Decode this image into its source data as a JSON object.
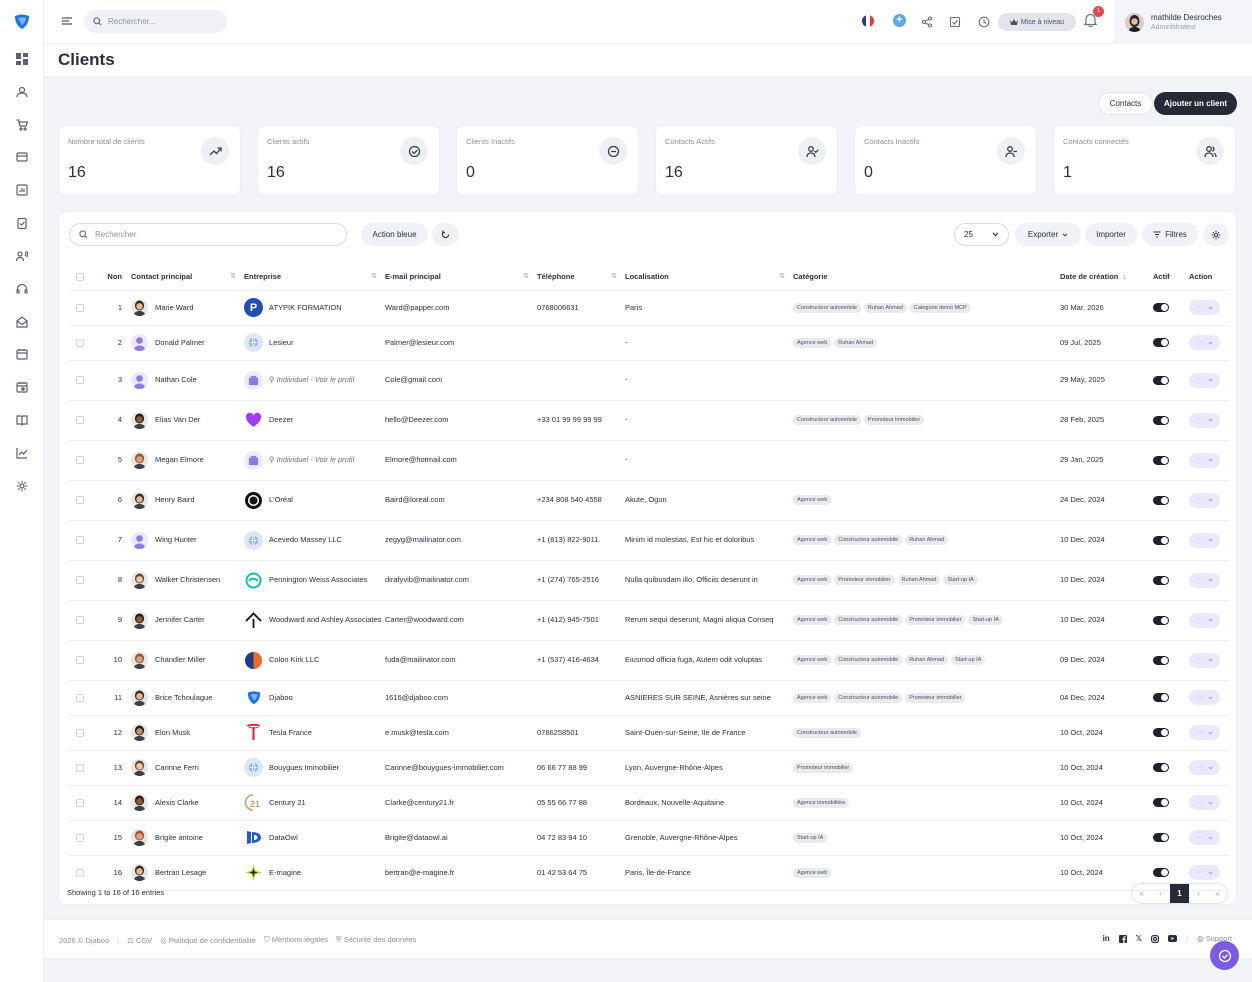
{
  "topbar": {
    "search_placeholder": "Rechercher...",
    "upgrade_label": "Mise à niveau",
    "notif_count": "1",
    "user_name": "mathilde Desroches",
    "user_role": "Administrateur"
  },
  "page": {
    "title": "Clients"
  },
  "actions": {
    "contacts_label": "Contacts",
    "add_label": "Ajouter un client"
  },
  "stats": [
    {
      "label": "Nombre total de clients",
      "value": "16",
      "icon": "trending-up-icon"
    },
    {
      "label": "Clients actifs",
      "value": "16",
      "icon": "check-circle-icon"
    },
    {
      "label": "Clients Inactifs",
      "value": "0",
      "icon": "minus-circle-icon"
    },
    {
      "label": "Contacts Actifs",
      "value": "16",
      "icon": "user-check-icon"
    },
    {
      "label": "Contacts Inactifs",
      "value": "0",
      "icon": "user-minus-icon"
    },
    {
      "label": "Contacts connectés",
      "value": "1",
      "icon": "users-icon"
    }
  ],
  "toolbar": {
    "search_placeholder": "Rechercher",
    "action_bleue": "Action bleue",
    "page_size": "25",
    "export_label": "Exporter",
    "import_label": "Importer",
    "filters_label": "Filtres"
  },
  "table": {
    "headers": {
      "num": "Non",
      "contact": "Contact principal",
      "company": "Entreprise",
      "email": "E-mail principal",
      "phone": "Téléphone",
      "location": "Localisation",
      "category": "Catégorie",
      "date": "Date de création",
      "active": "Actif",
      "action": "Action"
    },
    "rows": [
      {
        "num": "1",
        "contact": "Marie Ward",
        "company": "ATYPIK FORMATION",
        "email": "Ward@papper.com",
        "phone": "0768006631",
        "location": "Paris",
        "tags": [
          "Constructeur automobile",
          "Ruhan Ahmad",
          "Categorie demo MCP"
        ],
        "date": "30 Mar, 2026"
      },
      {
        "num": "2",
        "contact": "Donald Palmer",
        "company": "Lesieur",
        "email": "Palmer@lesieur.com",
        "phone": "",
        "location": "-",
        "tags": [
          "Agence web",
          "Ruhan Ahmad"
        ],
        "date": "09 Jul, 2025"
      },
      {
        "num": "3",
        "contact": "Nathan Cole",
        "company": "Individuel - Voir le profil",
        "email": "Cole@gmail.com",
        "phone": "",
        "location": "-",
        "tags": [],
        "date": "29 May, 2025"
      },
      {
        "num": "4",
        "contact": "Elias Van Der",
        "company": "Deezer",
        "email": "hello@Deezer.com",
        "phone": "+33 01 99 99 99 99",
        "location": "-",
        "tags": [
          "Constructeur automobile",
          "Promoteur immobilier"
        ],
        "date": "28 Feb, 2025"
      },
      {
        "num": "5",
        "contact": "Megan Elmore",
        "company": "Individuel - Voir le profil",
        "email": "Elmore@hotmail.com",
        "phone": "",
        "location": "-",
        "tags": [],
        "date": "29 Jan, 2025"
      },
      {
        "num": "6",
        "contact": "Henry Baird",
        "company": "L'Oréal",
        "email": "Baird@loreal.com",
        "phone": "+234 808 540 4558",
        "location": "Akute, Ogun",
        "tags": [
          "Agence web"
        ],
        "date": "24 Dec, 2024"
      },
      {
        "num": "7",
        "contact": "Wing Hunter",
        "company": "Acevedo Massey LLC",
        "email": "zegyg@mailinator.com",
        "phone": "+1 (813) 822-9011",
        "location": "Minim id molestias, Est hic et doloribus",
        "tags": [
          "Agence web",
          "Constructeur automobile",
          "Ruhan Ahmad"
        ],
        "date": "10 Dec, 2024"
      },
      {
        "num": "8",
        "contact": "Walker Christensen",
        "company": "Pennington Weiss Associates",
        "email": "dirafyvib@mailinator.com",
        "phone": "+1 (274) 765-2516",
        "location": "Nulla quibusdam illo, Officiis deserunt in",
        "tags": [
          "Agence web",
          "Promoteur immobilier",
          "Ruhan Ahmad",
          "Start-up IA"
        ],
        "date": "10 Dec, 2024"
      },
      {
        "num": "9",
        "contact": "Jennifer Carter",
        "company": "Woodward and Ashley Associates",
        "email": "Carter@woodward.com",
        "phone": "+1 (412) 945-7501",
        "location": "Rerum sequi deserunt, Magni aliqua Conseq",
        "tags": [
          "Agence web",
          "Constructeur automobile",
          "Promoteur immobilier",
          "Start-up IA"
        ],
        "date": "10 Dec, 2024"
      },
      {
        "num": "10",
        "contact": "Chandler Miller",
        "company": "Colon Kirk LLC",
        "email": "fuda@mailinator.com",
        "phone": "+1 (537) 416-4634",
        "location": "Eiusmod officia fuga, Autem odit voluptas",
        "tags": [
          "Agence web",
          "Constructeur automobile",
          "Ruhan Ahmad",
          "Start-up IA"
        ],
        "date": "09 Dec, 2024"
      },
      {
        "num": "11",
        "contact": "Brice Tchoulague",
        "company": "Djaboo",
        "email": "1616@djaboo.com",
        "phone": "",
        "location": "ASNIERES SUR SEINE, Asnières sur seine",
        "tags": [
          "Agence web",
          "Constructeur automobile",
          "Promoteur immobilier"
        ],
        "date": "04 Dec, 2024"
      },
      {
        "num": "12",
        "contact": "Elon Musk",
        "company": "Tesla France",
        "email": "e.musk@tesla.com",
        "phone": "0786258501",
        "location": "Saint-Ouen-sur-Seine, Ile de France",
        "tags": [
          "Constructeur automobile"
        ],
        "date": "10 Oct, 2024"
      },
      {
        "num": "13",
        "contact": "Carinne Ferri",
        "company": "Bouygues Immobilier",
        "email": "Carinne@bouygues-immobilier.com",
        "phone": "06 66 77 88 99",
        "location": "Lyon, Auvergne-Rhône-Alpes",
        "tags": [
          "Promoteur immobilier"
        ],
        "date": "10 Oct, 2024"
      },
      {
        "num": "14",
        "contact": "Alexis Clarke",
        "company": "Century 21",
        "email": "Clarke@century21.fr",
        "phone": "05 55 66 77 88",
        "location": "Bordeaux, Nouvelle-Aquitaine",
        "tags": [
          "Agence immobilière"
        ],
        "date": "10 Oct, 2024"
      },
      {
        "num": "15",
        "contact": "Brigite antoine",
        "company": "DataOwl",
        "email": "Brigite@dataowl.ai",
        "phone": "04 72 83 94 10",
        "location": "Grenoble, Auvergne-Rhône-Alpes",
        "tags": [
          "Start-up IA"
        ],
        "date": "10 Oct, 2024"
      },
      {
        "num": "16",
        "contact": "Bertran Lesage",
        "company": "E-magine",
        "email": "bertran@e-magine.fr",
        "phone": "01 42 53 64 75",
        "location": "Paris, Île-de-France",
        "tags": [
          "Agence web"
        ],
        "date": "10 Oct, 2024"
      }
    ]
  },
  "pagination": {
    "showing": "Showing 1 to 16 of 16 entries",
    "first": "«",
    "prev": "‹",
    "current": "1",
    "next": "›",
    "last": "»"
  },
  "footer": {
    "copyright": "2026 © Djaboo",
    "cgv": "CGV",
    "privacy": "Politique de confidentialité",
    "legal": "Mentions légales",
    "security": "Sécurité des données",
    "support": "Support"
  },
  "colors": {
    "primary_dark": "#252a36",
    "accent_purple": "#7b5be6",
    "logo_blue": "#1e73e8"
  }
}
